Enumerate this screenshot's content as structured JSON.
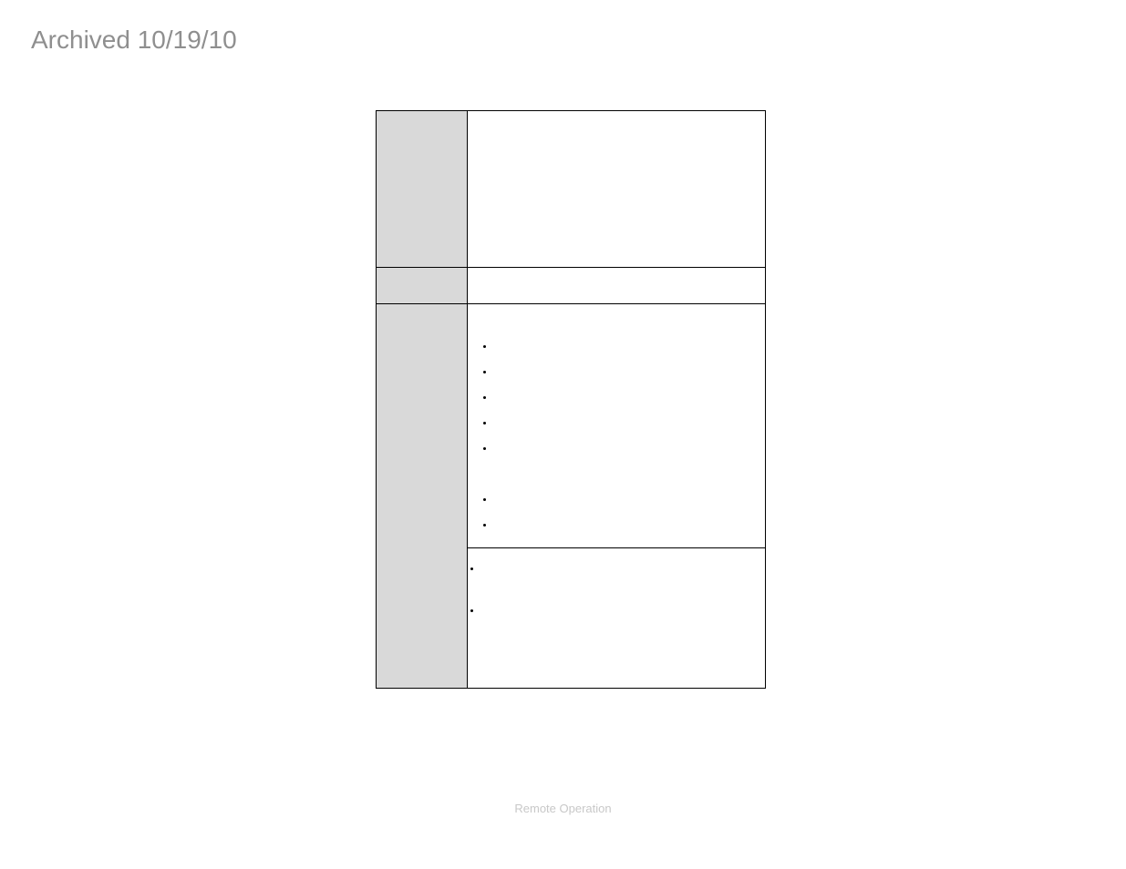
{
  "header": {
    "archived_text": "Archived 10/19/10"
  },
  "table": {
    "rows": [
      {
        "label": "",
        "content": ""
      },
      {
        "label": "",
        "content": ""
      },
      {
        "label": "",
        "bullets": [
          "",
          "",
          "",
          "",
          "",
          "",
          ""
        ]
      },
      {
        "bullets": [
          "",
          ""
        ]
      }
    ]
  },
  "footer": {
    "label": "Remote Operation"
  }
}
